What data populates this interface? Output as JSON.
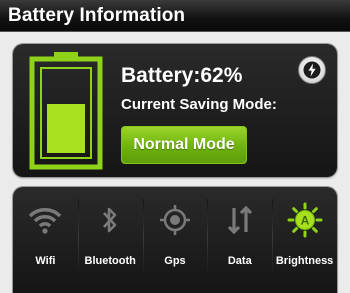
{
  "header": {
    "title": "Battery Information"
  },
  "battery": {
    "percent_text": "Battery:62%",
    "level": 0.62,
    "mode_label": "Current Saving Mode:",
    "mode_button": "Normal Mode",
    "fill_color": "#a8e01e",
    "outline_color": "#8fd21a"
  },
  "toggles": [
    {
      "label": "Wifi",
      "icon": "wifi-icon",
      "active": false
    },
    {
      "label": "Bluetooth",
      "icon": "bluetooth-icon",
      "active": false
    },
    {
      "label": "Gps",
      "icon": "gps-icon",
      "active": false
    },
    {
      "label": "Data",
      "icon": "data-icon",
      "active": false
    },
    {
      "label": "Brightness",
      "icon": "brightness-icon",
      "active": true
    }
  ],
  "colors": {
    "accent": "#8fd21a",
    "inactive_icon": "#7a7a7a"
  }
}
